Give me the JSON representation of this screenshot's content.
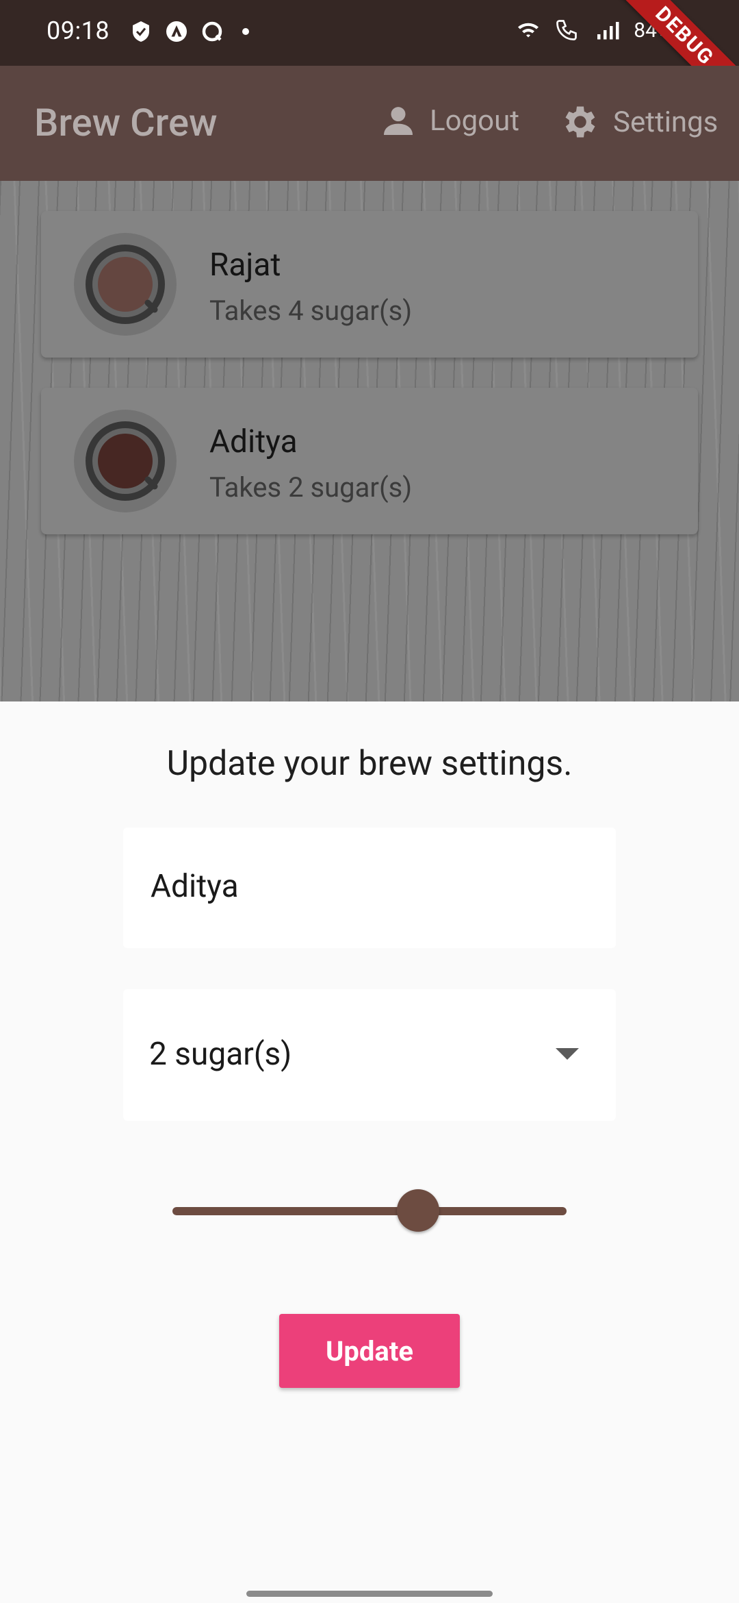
{
  "status_bar": {
    "time": "09:18",
    "battery": "84%",
    "debug_label": "DEBUG",
    "left_icons": [
      "shield-check-icon",
      "triangle-a-icon",
      "q-circle-icon",
      "dot-icon"
    ],
    "right_icons": [
      "wifi-icon",
      "volte-call-icon",
      "signal-icon",
      "battery-icon"
    ]
  },
  "app_bar": {
    "title": "Brew Crew",
    "logout_label": "Logout",
    "settings_label": "Settings",
    "background": "#5b4541"
  },
  "brews": [
    {
      "name": "Rajat",
      "subtitle": "Takes 4 sugar(s)",
      "cup_color": "#6a4a44"
    },
    {
      "name": "Aditya",
      "subtitle": "Takes 2 sugar(s)",
      "cup_color": "#4b2a25"
    }
  ],
  "settings_sheet": {
    "title": "Update your brew settings.",
    "name_value": "Aditya",
    "sugar_value": "2 sugar(s)",
    "strength_slider_fraction": 0.6,
    "update_label": "Update",
    "accent": "#ec407a",
    "slider_color": "#6d4c41"
  }
}
